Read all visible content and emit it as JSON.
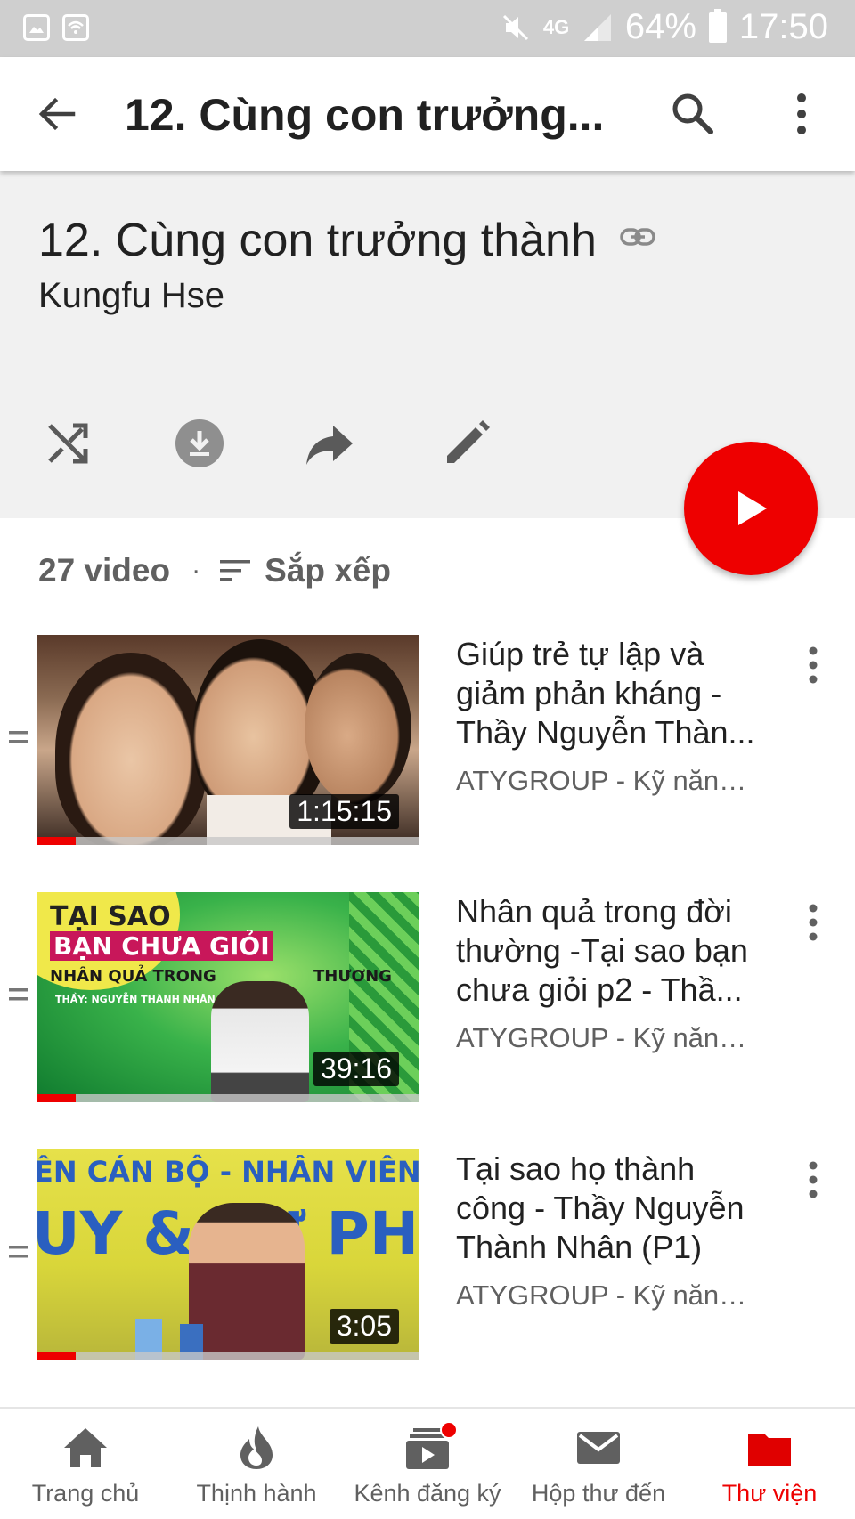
{
  "status_bar": {
    "network": "4G",
    "battery": "64%",
    "time": "17:50"
  },
  "app_bar": {
    "title": "12. Cùng con trưởng..."
  },
  "playlist": {
    "title": "12. Cùng con trưởng thành",
    "owner": "Kungfu Hse",
    "video_count": "27 video",
    "sort_label": "Sắp xếp"
  },
  "videos": [
    {
      "title": "Giúp trẻ tự lập và giảm phản kháng - Thầy Nguyễn Thàn...",
      "channel": "ATYGROUP - Kỹ năng ...",
      "duration": "1:15:15",
      "watched_fraction": 0.1
    },
    {
      "title": "Nhân quả trong đời thường -Tại sao bạn chưa giỏi p2 - Thầ...",
      "channel": "ATYGROUP - Kỹ năng ...",
      "duration": "39:16",
      "watched_fraction": 0.1,
      "thumb_text": {
        "line1": "TẠI SAO",
        "line2": "BẠN CHƯA GIỎI",
        "line3": "NHÂN QUẢ TRONG",
        "line4": "THƯƠNG",
        "line5": "THẦY: NGUYỄN THÀNH NHÂN"
      }
    },
    {
      "title": "Tại sao họ thành công - Thầy Nguyễn Thành Nhân (P1)",
      "channel": "ATYGROUP - Kỹ năng ...",
      "duration": "3:05",
      "watched_fraction": 0.1,
      "thumb_text": {
        "line1": "ÊN CÁN BỘ - NHÂN VIÊN",
        "line2": "UY & SỰ PHÓ"
      }
    }
  ],
  "bottom_nav": [
    {
      "label": "Trang chủ",
      "icon": "home-icon"
    },
    {
      "label": "Thịnh hành",
      "icon": "flame-icon"
    },
    {
      "label": "Kênh đăng ký",
      "icon": "subscriptions-icon"
    },
    {
      "label": "Hộp thư đến",
      "icon": "mail-icon"
    },
    {
      "label": "Thư viện",
      "icon": "folder-icon"
    }
  ],
  "colors": {
    "accent": "#e00000",
    "header_bg": "#f1f1f1",
    "status_bar_bg": "#cfcfcf",
    "secondary_text": "#606060"
  }
}
